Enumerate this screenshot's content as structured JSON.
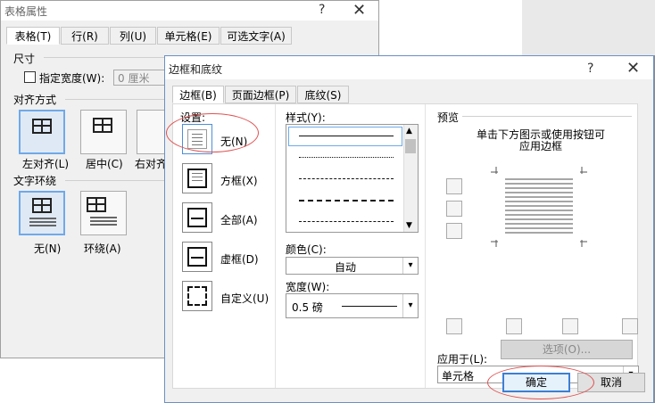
{
  "back_dialog": {
    "title": "表格属性",
    "help": "?",
    "close": "✕",
    "tabs": [
      "表格(T)",
      "行(R)",
      "列(U)",
      "单元格(E)",
      "可选文字(A)"
    ],
    "size_label": "尺寸",
    "specify_width_label": "指定宽度(W):",
    "width_value": "0 厘米",
    "alignment_label": "对齐方式",
    "align_options": [
      "左对齐(L)",
      "居中(C)",
      "右对齐"
    ],
    "wrap_label": "文字环绕",
    "wrap_options": [
      "无(N)",
      "环绕(A)"
    ]
  },
  "front_dialog": {
    "title": "边框和底纹",
    "help": "?",
    "close": "✕",
    "tabs": [
      "边框(B)",
      "页面边框(P)",
      "底纹(S)"
    ],
    "settings_label": "设置:",
    "settings": [
      "无(N)",
      "方框(X)",
      "全部(A)",
      "虚框(D)",
      "自定义(U)"
    ],
    "style_label": "样式(Y):",
    "color_label": "颜色(C):",
    "color_value": "自动",
    "width_label": "宽度(W):",
    "width_value": "0.5 磅",
    "preview_label": "预览",
    "preview_hint_1": "单击下方图示或使用按钮可",
    "preview_hint_2": "应用边框",
    "apply_to_label": "应用于(L):",
    "apply_to_value": "单元格",
    "options_button": "选项(O)...",
    "ok_button": "确定",
    "cancel_button": "取消"
  }
}
